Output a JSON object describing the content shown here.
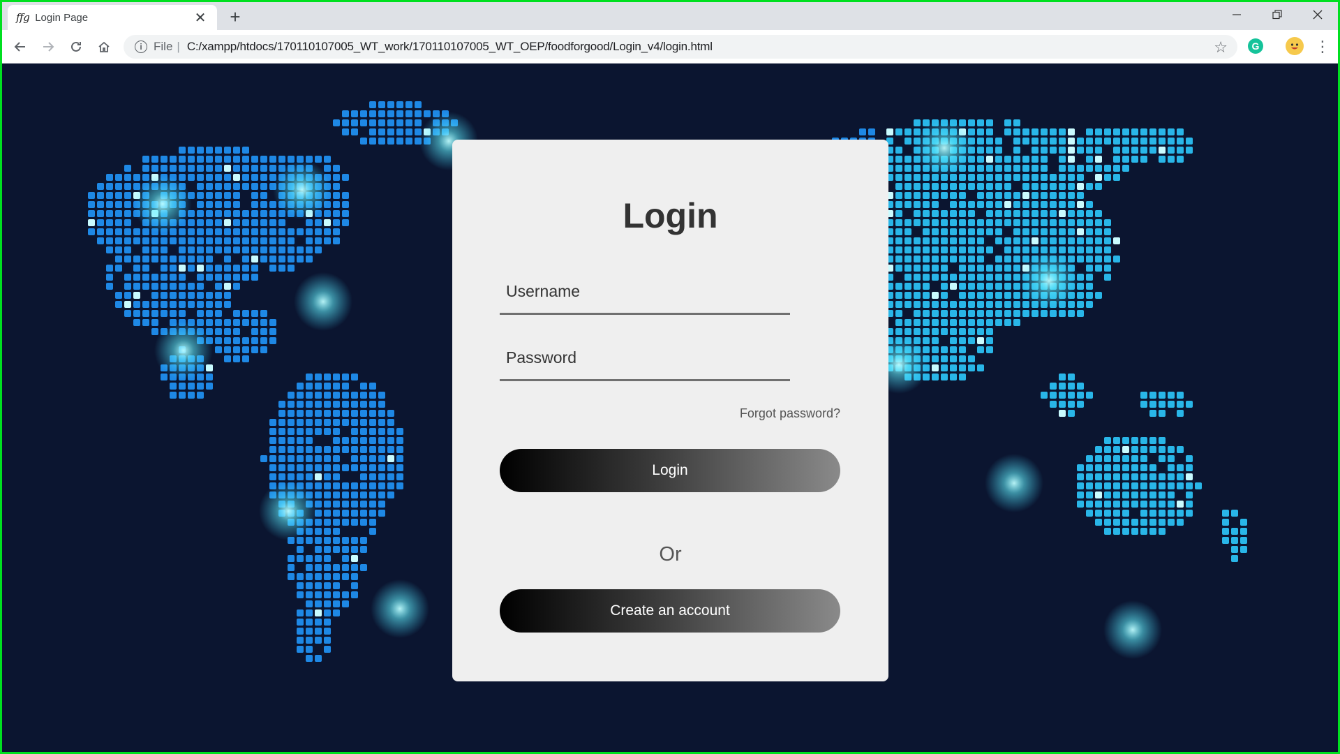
{
  "browser": {
    "tab": {
      "favicon_text": "ffg",
      "title": "Login Page",
      "close": "✕"
    },
    "new_tab": "+",
    "window_controls": {
      "minimize": "—",
      "restore": "❐",
      "close": "✕"
    },
    "address": {
      "scheme": "File",
      "separator": "|",
      "url": "C:/xampp/htdocs/170110107005_WT_work/170110107005_WT_OEP/foodforgood/Login_v4/login.html"
    },
    "extension_letter": "G"
  },
  "login": {
    "title": "Login",
    "username_placeholder": "Username",
    "password_placeholder": "Password",
    "forgot_label": "Forgot password?",
    "login_button": "Login",
    "or_label": "Or",
    "create_account_button": "Create an account"
  },
  "colors": {
    "page_background": "#0b1530",
    "map_dot": "#1e88e5",
    "map_dot_light": "#29b6e8",
    "map_glow": "#7ef9ff",
    "card_background": "#efefef",
    "button_gradient_start": "#000000",
    "button_gradient_end": "#8a8a8a"
  },
  "icons": [
    "back-arrow-icon",
    "forward-arrow-icon",
    "reload-icon",
    "home-icon",
    "info-icon",
    "star-icon",
    "grammarly-icon",
    "profile-avatar-icon",
    "more-menu-icon",
    "world-map"
  ]
}
